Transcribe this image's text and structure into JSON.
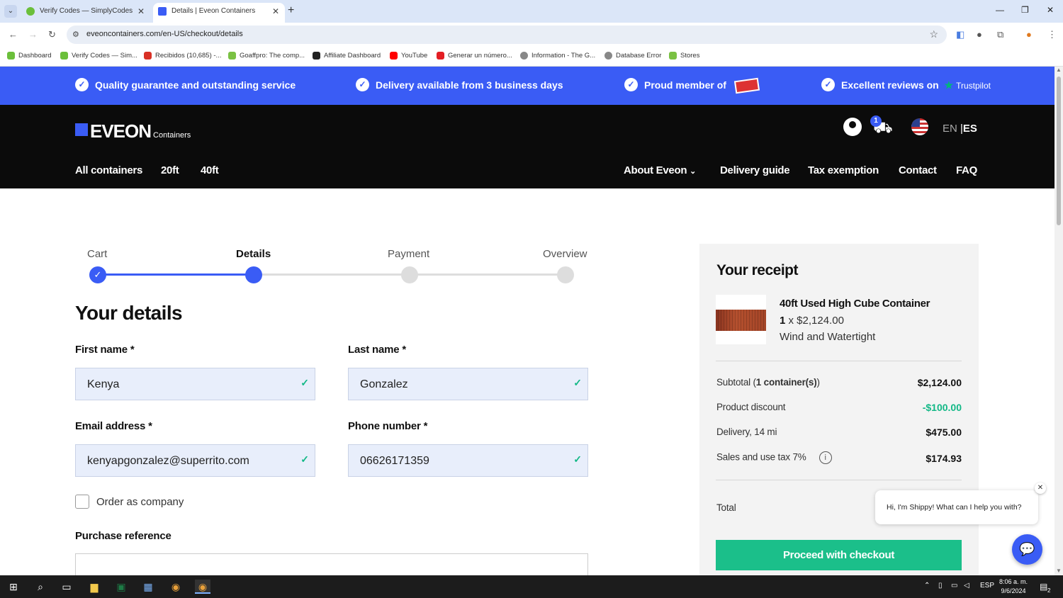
{
  "browser": {
    "tabs": [
      {
        "title": "Verify Codes — SimplyCodes",
        "active": false
      },
      {
        "title": "Details | Eveon Containers",
        "active": true
      }
    ],
    "url": "eveoncontainers.com/en-US/checkout/details",
    "bookmarks": [
      "Dashboard",
      "Verify Codes — Sim...",
      "Recibidos (10,685) -...",
      "Goaffpro: The comp...",
      "Affiliate Dashboard",
      "YouTube",
      "Generar un número...",
      "Information - The G...",
      "Database Error",
      "Stores"
    ]
  },
  "promo": {
    "items": [
      "Quality guarantee and outstanding service",
      "Delivery available from 3 business days",
      "Proud member of",
      "Excellent reviews on"
    ],
    "trustpilot": "Trustpilot"
  },
  "header": {
    "logo": "EVEON",
    "logo_sub": "Containers",
    "cart_count": "1",
    "lang_en": "EN",
    "lang_sep": "|",
    "lang_es": "ES",
    "nav_left": [
      "All containers",
      "20ft",
      "40ft"
    ],
    "nav_right": [
      "About Eveon",
      "Delivery guide",
      "Tax exemption",
      "Contact",
      "FAQ"
    ]
  },
  "stepper": {
    "steps": [
      "Cart",
      "Details",
      "Payment",
      "Overview"
    ],
    "current_index": 1
  },
  "form": {
    "title": "Your details",
    "first_name_label": "First name *",
    "first_name_value": "Kenya",
    "last_name_label": "Last name *",
    "last_name_value": "Gonzalez",
    "email_label": "Email address *",
    "email_value": "kenyapgonzalez@superrito.com",
    "phone_label": "Phone number *",
    "phone_value": "06626171359",
    "company_label": "Order as company",
    "reference_label": "Purchase reference"
  },
  "receipt": {
    "title": "Your receipt",
    "product_name": "40ft Used High Cube Container",
    "product_qty": "1",
    "product_price": "x $2,124.00",
    "product_condition": "Wind and Watertight",
    "subtotal_label": "Subtotal (",
    "subtotal_count": "1 container(s)",
    "subtotal_close": ")",
    "subtotal_value": "$2,124.00",
    "discount_label": "Product discount",
    "discount_value": "-$100.00",
    "delivery_label": "Delivery, 14 mi",
    "delivery_value": "$475.00",
    "tax_label": "Sales and use tax 7%",
    "tax_value": "$174.93",
    "total_label": "Total",
    "checkout_label": "Proceed with checkout"
  },
  "chat": {
    "message": "Hi, I'm Shippy! What can I help you with?"
  },
  "taskbar": {
    "time": "8:06 a. m.",
    "date": "9/6/2024",
    "lang": "ESP",
    "notif_count": "2"
  },
  "colors": {
    "brand_blue": "#3a5cf5",
    "success_green": "#1bbf8a",
    "header_bg": "#0b0b0b"
  }
}
